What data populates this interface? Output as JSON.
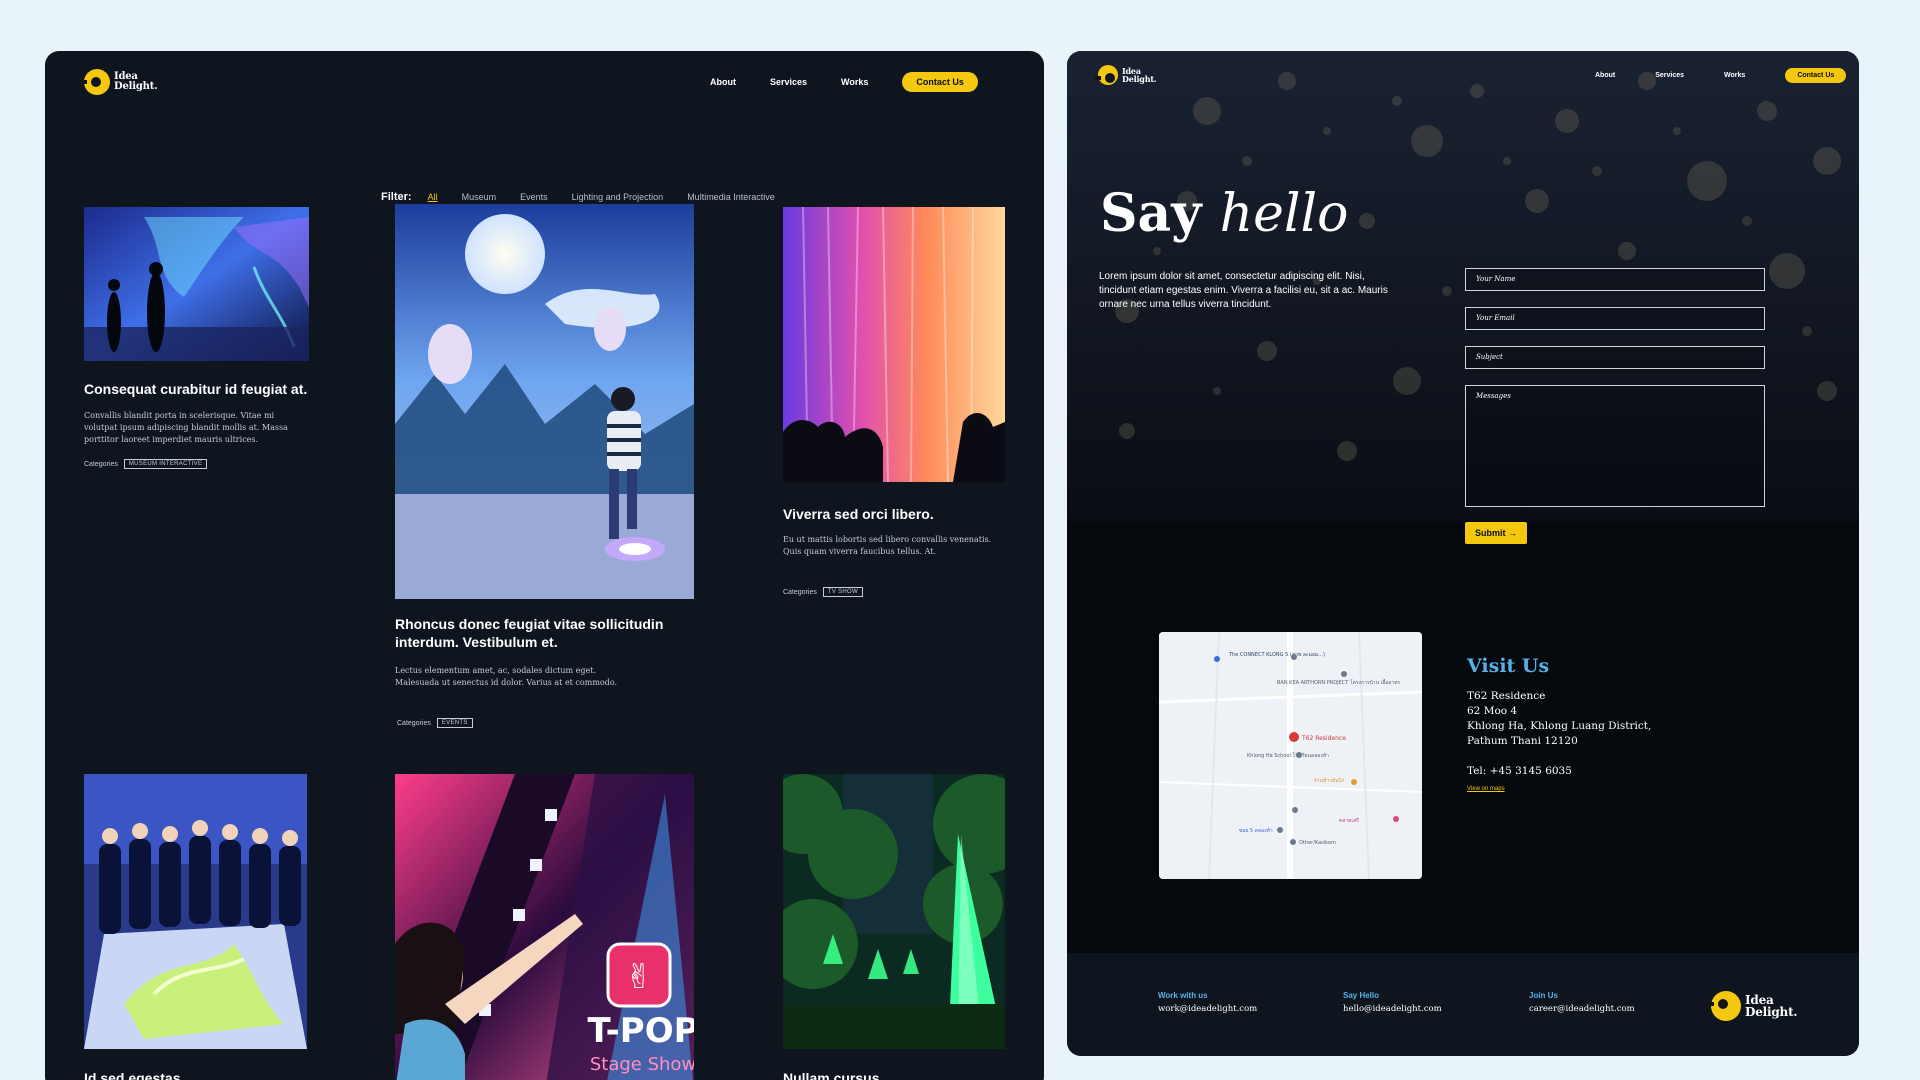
{
  "brand": {
    "logo_line1": "Idea",
    "logo_line2": "Delight."
  },
  "works_page": {
    "nav": {
      "about": "About",
      "services": "Services",
      "works": "Works",
      "contact": "Contact Us"
    },
    "filter": {
      "label": "Filter:",
      "items": [
        "All",
        "Museum",
        "Events",
        "Lighting and Projection",
        "Multimedia Interactive"
      ],
      "active": "All"
    },
    "categories_label": "Categories",
    "cards": [
      {
        "title": "Consequat curabitur id feugiat at.",
        "desc": "Convallis blandit porta in scelerisque. Vitae mi volutpat ipsum adipiscing blandit mollis at. Massa porttitor laoreet imperdiet mauris ultrices.",
        "category": "MUSEUM INTERACTIVE"
      },
      {
        "title": "Rhoncus donec feugiat vitae sollicitudin interdum. Vestibulum et.",
        "desc": "Lectus elementum amet, ac, sodales dictum eget. Malesuada ut senectus id dolor. Varius at et commodo.",
        "category": "EVENTS"
      },
      {
        "title": "Viverra sed orci libero.",
        "desc": "Eu ut mattis lobortis sed libero convallis venenatis. Quis quam viverra faucibus tellus. At.",
        "category": "TV SHOW"
      },
      {
        "title": "Id sed egestas"
      },
      {
        "title": ""
      },
      {
        "title": "Nullam cursus"
      }
    ],
    "tpop": {
      "line1": "T-POP",
      "line2": "Stage Show"
    }
  },
  "contact_page": {
    "nav": {
      "about": "About",
      "services": "Services",
      "works": "Works",
      "contact": "Contact Us"
    },
    "heading_bold": "Say",
    "heading_italic": "hello",
    "description": "Lorem ipsum dolor sit amet, consectetur adipiscing elit. Nisi, tincidunt etiam egestas enim. Viverra a facilisi eu, sit a ac. Mauris ornare nec urna tellus viverra tincidunt.",
    "form": {
      "name_placeholder": "Your Name",
      "email_placeholder": "Your Email",
      "subject_placeholder": "Subject",
      "message_placeholder": "Messages",
      "submit": "Submit →"
    },
    "map_labels": {
      "pin_main": "T62 Residence",
      "connect": "The CONNECT KLONG 5 (ภาพ ละมอม...)",
      "ban_kea": "BAN KEA ARTHORN PROJECT โครงการบ้าน เอื้ออาทร",
      "school": "Khlong Ha School โรงเรียนคลองห้า",
      "shop": "ร้านข้าวมันไก่",
      "market": "ตลาดเสรี",
      "road": "ซอย 5 คลองห้า",
      "other": "Other/Kasikorn"
    },
    "visit": {
      "title": "Visit Us",
      "line1": "T62 Residence",
      "line2": "62 Moo 4",
      "line3": "Khlong Ha, Khlong Luang District,",
      "line4": "Pathum Thani 12120",
      "tel": "Tel: +45 3145 6035",
      "view_maps": "View on maps"
    },
    "footer": {
      "work_head": "Work with us",
      "work_mail": "work@ideadelight.com",
      "hello_head": "Say Hello",
      "hello_mail": "hello@ideadelight.com",
      "join_head": "Join Us",
      "join_mail": "career@ideadelight.com"
    }
  },
  "colors": {
    "accent": "#f4c80f",
    "blue": "#56b3e8",
    "dark": "#0f151f",
    "background": "#e9f3fa"
  }
}
